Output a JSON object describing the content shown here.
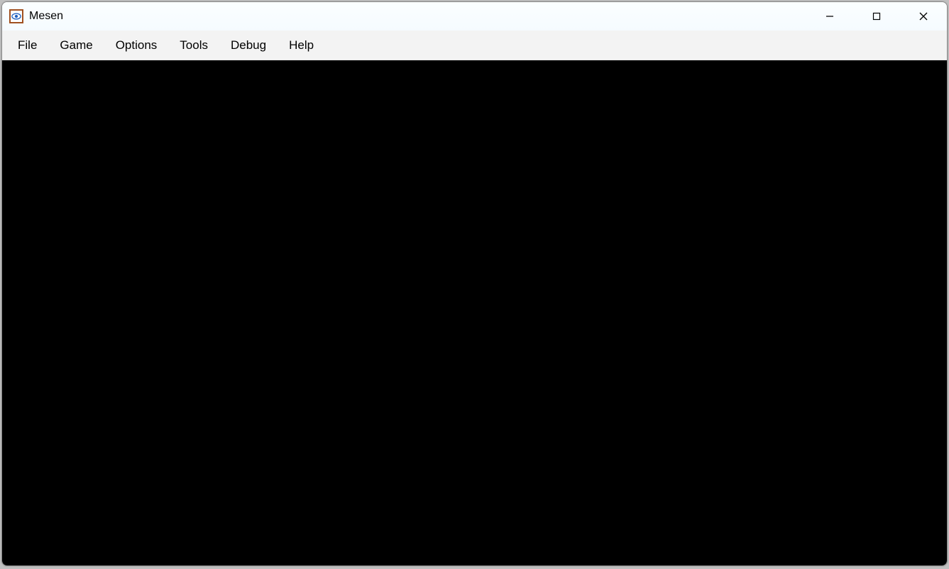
{
  "titlebar": {
    "app_name": "Mesen",
    "icon_name": "mesen-eye-icon"
  },
  "window_controls": {
    "minimize": "minimize",
    "maximize": "maximize",
    "close": "close"
  },
  "menubar": {
    "items": [
      {
        "label": "File"
      },
      {
        "label": "Game"
      },
      {
        "label": "Options"
      },
      {
        "label": "Tools"
      },
      {
        "label": "Debug"
      },
      {
        "label": "Help"
      }
    ]
  }
}
